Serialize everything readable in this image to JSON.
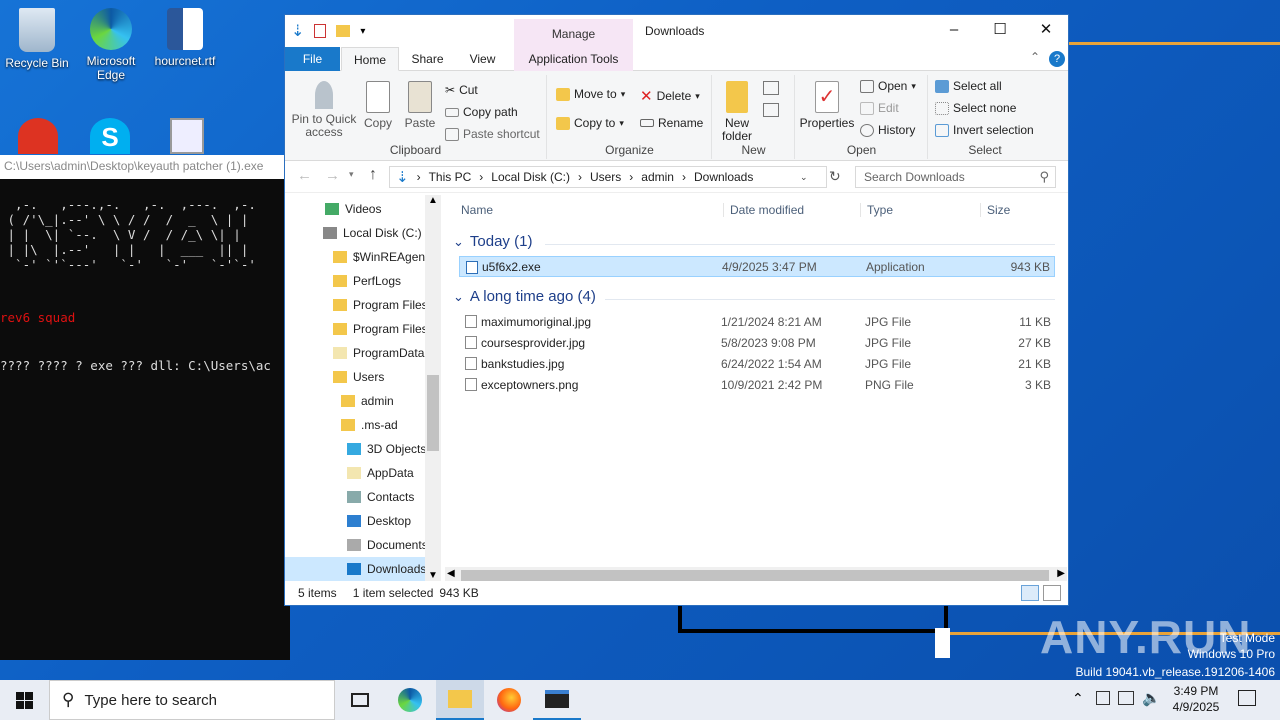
{
  "desktop": {
    "icons": [
      {
        "label": "Recycle Bin",
        "icon": "recycle-bin-icon"
      },
      {
        "label": "Microsoft Edge",
        "icon": "edge-icon"
      },
      {
        "label": "hourcnet.rtf",
        "icon": "word-document-icon"
      }
    ],
    "watermark": "ANY.RUN",
    "test_mode": "Test Mode",
    "os_name": "Windows 10 Pro",
    "build": "Build 19041.vb_release.191206-1406"
  },
  "console": {
    "title": "C:\\Users\\admin\\Desktop\\keyauth patcher (1).exe",
    "squad": "rev6 squad",
    "prompt": "???? ???? ? exe ??? dll: C:\\Users\\ac"
  },
  "explorer": {
    "title": "Downloads",
    "manage_label": "Manage",
    "tabs": {
      "file": "File",
      "home": "Home",
      "share": "Share",
      "view": "View",
      "app_tools": "Application Tools"
    },
    "ribbon": {
      "pin": "Pin to Quick access",
      "copy": "Copy",
      "paste": "Paste",
      "cut": "Cut",
      "copy_path": "Copy path",
      "paste_shortcut": "Paste shortcut",
      "clipboard": "Clipboard",
      "move_to": "Move to",
      "copy_to": "Copy to",
      "delete": "Delete",
      "rename": "Rename",
      "organize": "Organize",
      "new_folder": "New folder",
      "new": "New",
      "properties": "Properties",
      "open": "Open",
      "edit": "Edit",
      "history": "History",
      "open_group": "Open",
      "select_all": "Select all",
      "select_none": "Select none",
      "invert_selection": "Invert selection",
      "select": "Select"
    },
    "breadcrumb": [
      "This PC",
      "Local Disk (C:)",
      "Users",
      "admin",
      "Downloads"
    ],
    "search_placeholder": "Search Downloads",
    "nav": [
      "Videos",
      "Local Disk (C:)",
      "$WinREAgent",
      "PerfLogs",
      "Program Files",
      "Program Files",
      "ProgramData",
      "Users",
      "admin",
      ".ms-ad",
      "3D Objects",
      "AppData",
      "Contacts",
      "Desktop",
      "Documents",
      "Downloads"
    ],
    "columns": {
      "name": "Name",
      "date": "Date modified",
      "type": "Type",
      "size": "Size"
    },
    "groups": [
      {
        "label": "Today (1)",
        "files": [
          {
            "name": "u5f6x2.exe",
            "date": "4/9/2025 3:47 PM",
            "type": "Application",
            "size": "943 KB"
          }
        ]
      },
      {
        "label": "A long time ago (4)",
        "files": [
          {
            "name": "maximumoriginal.jpg",
            "date": "1/21/2024 8:21 AM",
            "type": "JPG File",
            "size": "11 KB"
          },
          {
            "name": "coursesprovider.jpg",
            "date": "5/8/2023 9:08 PM",
            "type": "JPG File",
            "size": "27 KB"
          },
          {
            "name": "bankstudies.jpg",
            "date": "6/24/2022 1:54 AM",
            "type": "JPG File",
            "size": "21 KB"
          },
          {
            "name": "exceptowners.png",
            "date": "10/9/2021 2:42 PM",
            "type": "PNG File",
            "size": "3 KB"
          }
        ]
      }
    ],
    "status": {
      "count": "5 items",
      "selected": "1 item selected",
      "size": "943 KB"
    }
  },
  "taskbar": {
    "search_placeholder": "Type here to search",
    "time": "3:49 PM",
    "date": "4/9/2025"
  },
  "colors": {
    "accent": "#1979ca",
    "selection": "#cce8ff",
    "manage": "#f6e6f5",
    "ascii_red": "#dd1111"
  }
}
